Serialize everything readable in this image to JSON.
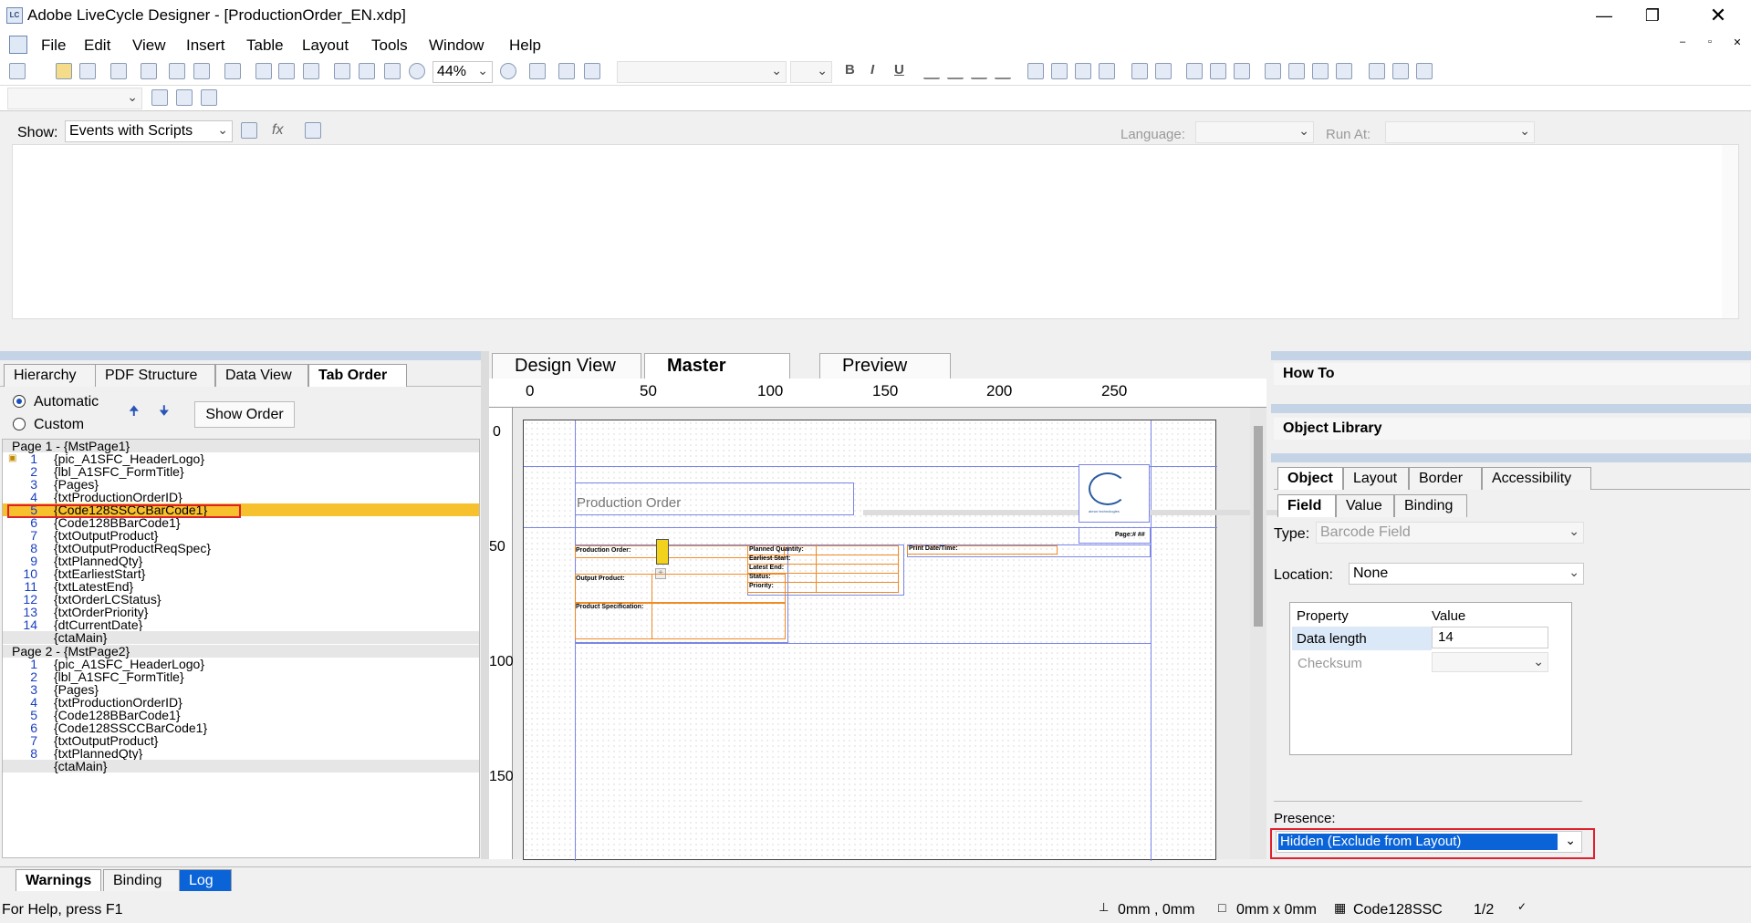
{
  "window": {
    "title": "Adobe LiveCycle Designer - [ProductionOrder_EN.xdp]",
    "icon_text": "LC"
  },
  "menu": [
    "File",
    "Edit",
    "View",
    "Insert",
    "Table",
    "Layout",
    "Tools",
    "Window",
    "Help"
  ],
  "toolbar": {
    "zoom": "44%",
    "bold": "B",
    "italic": "I",
    "underline": "U"
  },
  "script_editor": {
    "show_label": "Show:",
    "show_value": "Events with Scripts",
    "language_label": "Language:",
    "run_at_label": "Run At:",
    "fx": "fx"
  },
  "left_panel": {
    "tabs": [
      "Hierarchy",
      "PDF Structure",
      "Data View",
      "Tab Order"
    ],
    "active_tab": "Tab Order",
    "automatic_label": "Automatic",
    "custom_label": "Custom",
    "show_order_button": "Show Order",
    "tree": [
      {
        "num": "",
        "text": "Page 1 - {MstPage1}",
        "group": true
      },
      {
        "num": "1",
        "text": "{pic_A1SFC_HeaderLogo}",
        "locked": true
      },
      {
        "num": "2",
        "text": "{lbl_A1SFC_FormTitle}"
      },
      {
        "num": "3",
        "text": "{Pages}"
      },
      {
        "num": "4",
        "text": "{txtProductionOrderID}"
      },
      {
        "num": "5",
        "text": "{Code128SSCCBarCode1}",
        "selected": true
      },
      {
        "num": "6",
        "text": "{Code128BBarCode1}"
      },
      {
        "num": "7",
        "text": "{txtOutputProduct}"
      },
      {
        "num": "8",
        "text": "{txtOutputProductReqSpec}"
      },
      {
        "num": "9",
        "text": "{txtPlannedQty}"
      },
      {
        "num": "10",
        "text": "{txtEarliestStart}"
      },
      {
        "num": "11",
        "text": "{txtLatestEnd}"
      },
      {
        "num": "12",
        "text": "{txtOrderLCStatus}"
      },
      {
        "num": "13",
        "text": "{txtOrderPriority}"
      },
      {
        "num": "14",
        "text": "{dtCurrentDate}"
      },
      {
        "num": "",
        "text": "{ctaMain}",
        "shaded": true
      },
      {
        "num": "",
        "text": "Page 2 - {MstPage2}",
        "group": true
      },
      {
        "num": "1",
        "text": "{pic_A1SFC_HeaderLogo}"
      },
      {
        "num": "2",
        "text": "{lbl_A1SFC_FormTitle}"
      },
      {
        "num": "3",
        "text": "{Pages}"
      },
      {
        "num": "4",
        "text": "{txtProductionOrderID}"
      },
      {
        "num": "5",
        "text": "{Code128BBarCode1}"
      },
      {
        "num": "6",
        "text": "{Code128SSCCBarCode1}"
      },
      {
        "num": "7",
        "text": "{txtOutputProduct}"
      },
      {
        "num": "8",
        "text": "{txtPlannedQty}"
      },
      {
        "num": "",
        "text": "{ctaMain}",
        "shaded": true
      }
    ]
  },
  "doc_tabs": [
    "Design View",
    "Master Pages",
    "Preview PDF"
  ],
  "active_doc_tab": "Master Pages",
  "ruler": {
    "h": [
      "0",
      "50",
      "100",
      "150",
      "200",
      "250"
    ],
    "v": [
      "0",
      "50",
      "100",
      "150"
    ]
  },
  "form": {
    "title": "Production Order",
    "page_label": "Page:# ##",
    "logo_text": "abrun technologies",
    "production_order": "Production Order:",
    "output_product": "Output Product:",
    "product_spec": "Product Specification:",
    "planned_qty": "Planned Quantity:",
    "earliest_start": "Earliest Start:",
    "latest_end": "Latest End:",
    "status": "Status:",
    "priority": "Priority:",
    "print_date": "Print Date/Time:"
  },
  "right_panel": {
    "how_to": "How To",
    "object_library": "Object Library",
    "object_tabs": [
      "Object",
      "Layout",
      "Border",
      "Accessibility"
    ],
    "sub_tabs": [
      "Field",
      "Value",
      "Binding"
    ],
    "type_label": "Type:",
    "type_value": "Barcode Field",
    "location_label": "Location:",
    "location_value": "None",
    "grid_headers": [
      "Property",
      "Value"
    ],
    "grid_rows": [
      {
        "property": "Data length",
        "value": "14"
      },
      {
        "property": "Checksum",
        "value": ""
      }
    ],
    "presence_label": "Presence:",
    "presence_value": "Hidden (Exclude from Layout)"
  },
  "bottom_tabs": [
    "Warnings",
    "Binding",
    "Log"
  ],
  "status": {
    "help": "For Help, press F1",
    "position": "0mm , 0mm",
    "size": "0mm x 0mm",
    "object": "Code128SSC",
    "page": "1/2"
  },
  "colors": {
    "selection": "#f7c12d",
    "highlight_box": "#e0202c",
    "accent_blue": "#0a64d8",
    "orange_field": "#f08a24"
  }
}
